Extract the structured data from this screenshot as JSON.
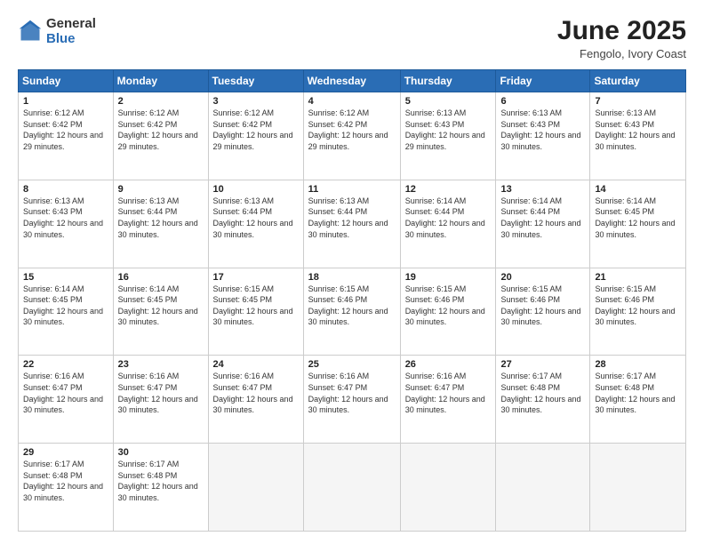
{
  "logo": {
    "general": "General",
    "blue": "Blue"
  },
  "title": "June 2025",
  "subtitle": "Fengolo, Ivory Coast",
  "days": [
    "Sunday",
    "Monday",
    "Tuesday",
    "Wednesday",
    "Thursday",
    "Friday",
    "Saturday"
  ],
  "weeks": [
    [
      {
        "day": "1",
        "sunrise": "6:12 AM",
        "sunset": "6:42 PM",
        "daylight": "12 hours and 29 minutes."
      },
      {
        "day": "2",
        "sunrise": "6:12 AM",
        "sunset": "6:42 PM",
        "daylight": "12 hours and 29 minutes."
      },
      {
        "day": "3",
        "sunrise": "6:12 AM",
        "sunset": "6:42 PM",
        "daylight": "12 hours and 29 minutes."
      },
      {
        "day": "4",
        "sunrise": "6:12 AM",
        "sunset": "6:42 PM",
        "daylight": "12 hours and 29 minutes."
      },
      {
        "day": "5",
        "sunrise": "6:13 AM",
        "sunset": "6:43 PM",
        "daylight": "12 hours and 29 minutes."
      },
      {
        "day": "6",
        "sunrise": "6:13 AM",
        "sunset": "6:43 PM",
        "daylight": "12 hours and 30 minutes."
      },
      {
        "day": "7",
        "sunrise": "6:13 AM",
        "sunset": "6:43 PM",
        "daylight": "12 hours and 30 minutes."
      }
    ],
    [
      {
        "day": "8",
        "sunrise": "6:13 AM",
        "sunset": "6:43 PM",
        "daylight": "12 hours and 30 minutes."
      },
      {
        "day": "9",
        "sunrise": "6:13 AM",
        "sunset": "6:44 PM",
        "daylight": "12 hours and 30 minutes."
      },
      {
        "day": "10",
        "sunrise": "6:13 AM",
        "sunset": "6:44 PM",
        "daylight": "12 hours and 30 minutes."
      },
      {
        "day": "11",
        "sunrise": "6:13 AM",
        "sunset": "6:44 PM",
        "daylight": "12 hours and 30 minutes."
      },
      {
        "day": "12",
        "sunrise": "6:14 AM",
        "sunset": "6:44 PM",
        "daylight": "12 hours and 30 minutes."
      },
      {
        "day": "13",
        "sunrise": "6:14 AM",
        "sunset": "6:44 PM",
        "daylight": "12 hours and 30 minutes."
      },
      {
        "day": "14",
        "sunrise": "6:14 AM",
        "sunset": "6:45 PM",
        "daylight": "12 hours and 30 minutes."
      }
    ],
    [
      {
        "day": "15",
        "sunrise": "6:14 AM",
        "sunset": "6:45 PM",
        "daylight": "12 hours and 30 minutes."
      },
      {
        "day": "16",
        "sunrise": "6:14 AM",
        "sunset": "6:45 PM",
        "daylight": "12 hours and 30 minutes."
      },
      {
        "day": "17",
        "sunrise": "6:15 AM",
        "sunset": "6:45 PM",
        "daylight": "12 hours and 30 minutes."
      },
      {
        "day": "18",
        "sunrise": "6:15 AM",
        "sunset": "6:46 PM",
        "daylight": "12 hours and 30 minutes."
      },
      {
        "day": "19",
        "sunrise": "6:15 AM",
        "sunset": "6:46 PM",
        "daylight": "12 hours and 30 minutes."
      },
      {
        "day": "20",
        "sunrise": "6:15 AM",
        "sunset": "6:46 PM",
        "daylight": "12 hours and 30 minutes."
      },
      {
        "day": "21",
        "sunrise": "6:15 AM",
        "sunset": "6:46 PM",
        "daylight": "12 hours and 30 minutes."
      }
    ],
    [
      {
        "day": "22",
        "sunrise": "6:16 AM",
        "sunset": "6:47 PM",
        "daylight": "12 hours and 30 minutes."
      },
      {
        "day": "23",
        "sunrise": "6:16 AM",
        "sunset": "6:47 PM",
        "daylight": "12 hours and 30 minutes."
      },
      {
        "day": "24",
        "sunrise": "6:16 AM",
        "sunset": "6:47 PM",
        "daylight": "12 hours and 30 minutes."
      },
      {
        "day": "25",
        "sunrise": "6:16 AM",
        "sunset": "6:47 PM",
        "daylight": "12 hours and 30 minutes."
      },
      {
        "day": "26",
        "sunrise": "6:16 AM",
        "sunset": "6:47 PM",
        "daylight": "12 hours and 30 minutes."
      },
      {
        "day": "27",
        "sunrise": "6:17 AM",
        "sunset": "6:48 PM",
        "daylight": "12 hours and 30 minutes."
      },
      {
        "day": "28",
        "sunrise": "6:17 AM",
        "sunset": "6:48 PM",
        "daylight": "12 hours and 30 minutes."
      }
    ],
    [
      {
        "day": "29",
        "sunrise": "6:17 AM",
        "sunset": "6:48 PM",
        "daylight": "12 hours and 30 minutes."
      },
      {
        "day": "30",
        "sunrise": "6:17 AM",
        "sunset": "6:48 PM",
        "daylight": "12 hours and 30 minutes."
      },
      null,
      null,
      null,
      null,
      null
    ]
  ]
}
